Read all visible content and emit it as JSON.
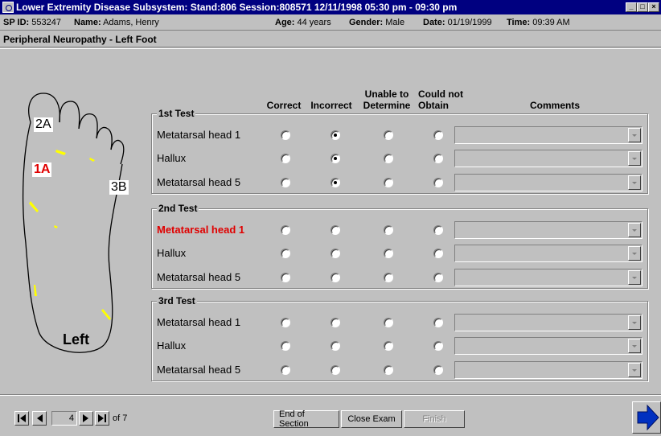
{
  "window": {
    "title": "Lower Extremity Disease Subsystem: Stand:806 Session:808571 12/11/1998 05:30 pm - 09:30 pm",
    "min_glyph": "_",
    "max_glyph": "□",
    "close_glyph": "×"
  },
  "info": {
    "sp_id_label": "SP ID:",
    "sp_id": "553247",
    "name_label": "Name:",
    "name": "Adams, Henry",
    "age_label": "Age:",
    "age": "44 years",
    "gender_label": "Gender:",
    "gender": "Male",
    "date_label": "Date:",
    "date": "01/19/1999",
    "time_label": "Time:",
    "time": "09:39 AM"
  },
  "section_title": "Peripheral Neuropathy - Left Foot",
  "foot": {
    "zone_2a": "2A",
    "zone_1a": "1A",
    "zone_3b": "3B",
    "side_label": "Left"
  },
  "columns": {
    "correct": "Correct",
    "incorrect": "Incorrect",
    "unable_1": "Unable to",
    "unable_2": "Determine",
    "could_not_1": "Could not",
    "could_not_2": "Obtain",
    "comments": "Comments"
  },
  "tests": [
    {
      "legend": "1st Test",
      "rows": [
        {
          "label": "Metatarsal head 1",
          "selected": "incorrect",
          "highlight": false
        },
        {
          "label": "Hallux",
          "selected": "incorrect",
          "highlight": false
        },
        {
          "label": "Metatarsal head 5",
          "selected": "incorrect",
          "highlight": false
        }
      ]
    },
    {
      "legend": "2nd Test",
      "rows": [
        {
          "label": "Metatarsal head 1",
          "selected": null,
          "highlight": true
        },
        {
          "label": "Hallux",
          "selected": null,
          "highlight": false
        },
        {
          "label": "Metatarsal head 5",
          "selected": null,
          "highlight": false
        }
      ]
    },
    {
      "legend": "3rd Test",
      "rows": [
        {
          "label": "Metatarsal head 1",
          "selected": null,
          "highlight": false
        },
        {
          "label": "Hallux",
          "selected": null,
          "highlight": false
        },
        {
          "label": "Metatarsal head 5",
          "selected": null,
          "highlight": false
        }
      ]
    }
  ],
  "nav": {
    "page": "4",
    "of_label": "of 7"
  },
  "buttons": {
    "end_of_section": "End of Section",
    "close_exam": "Close Exam",
    "finish": "Finish"
  },
  "colors": {
    "titlebar": "#000080",
    "highlight_red": "#e00000",
    "foot_marks": "#ffff00",
    "next_arrow": "#0030c0"
  }
}
